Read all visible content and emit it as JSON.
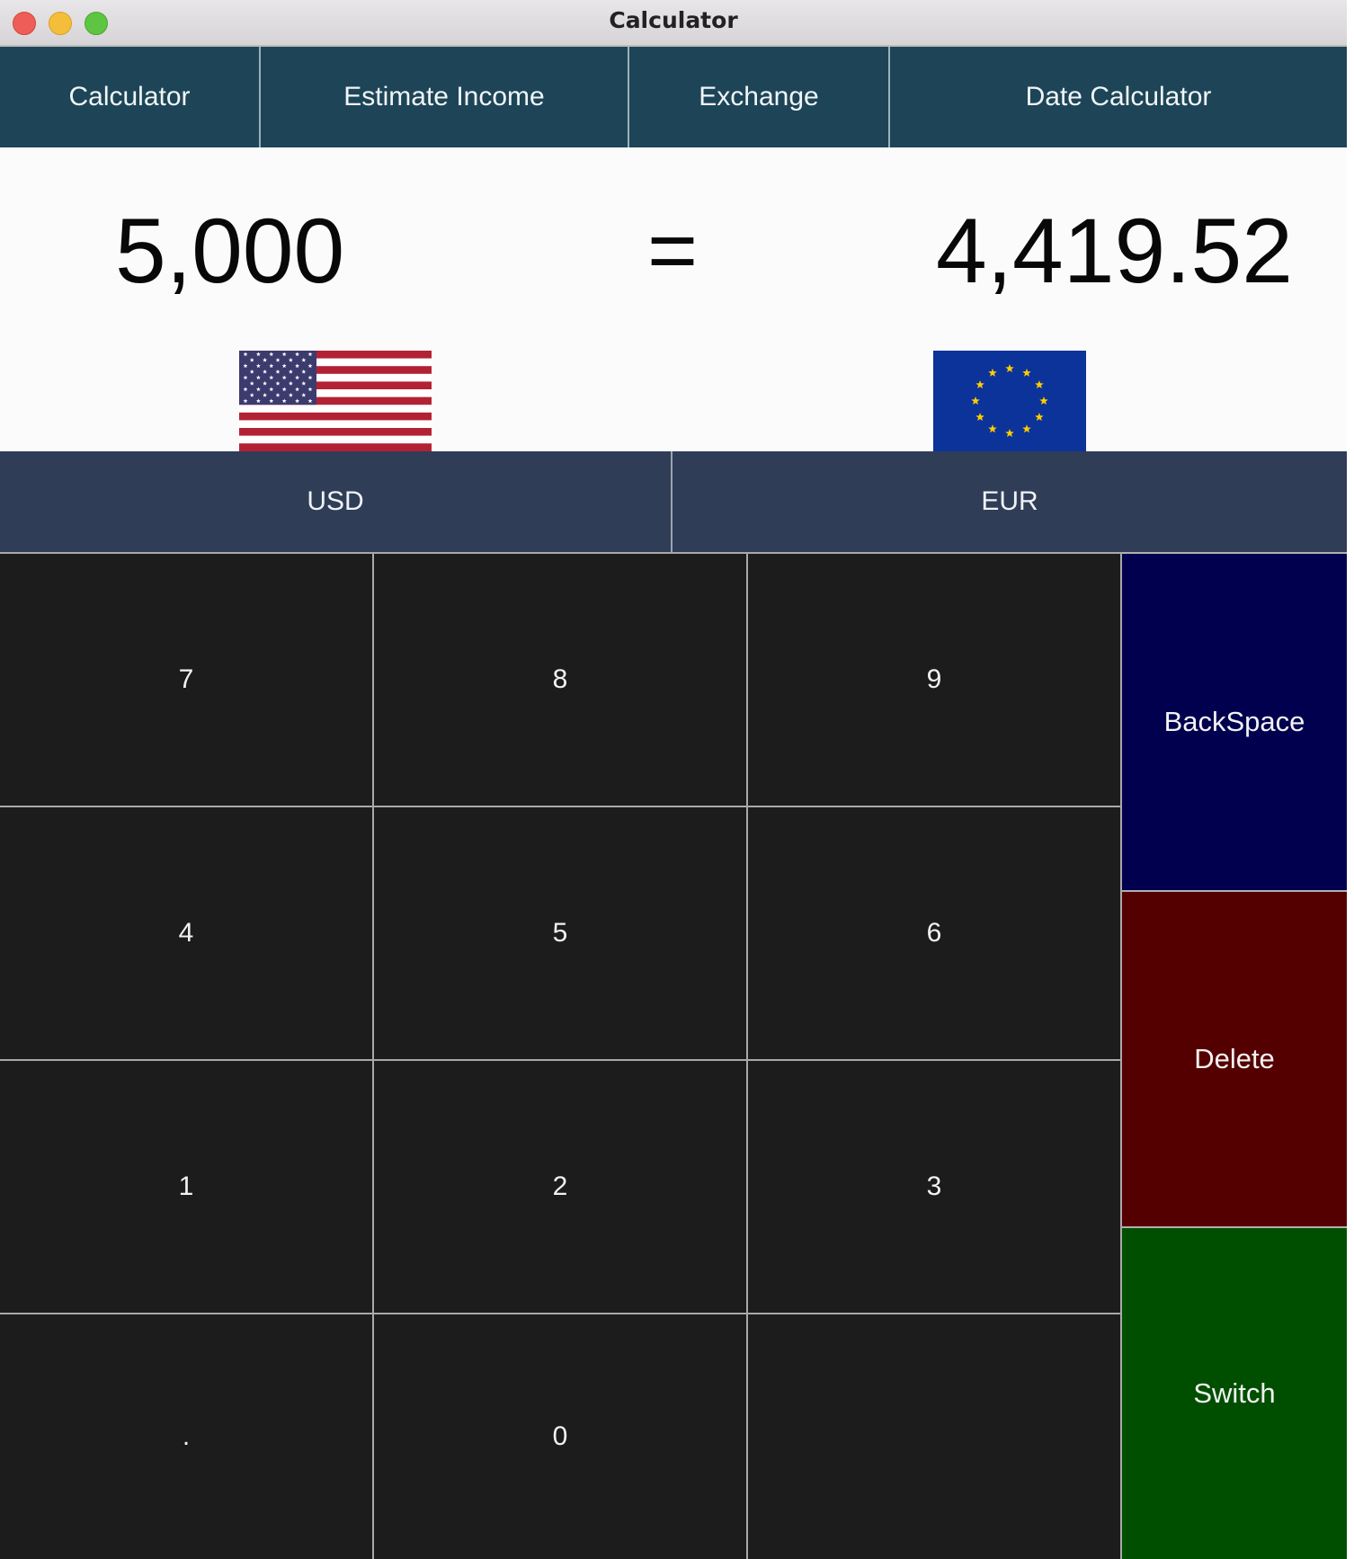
{
  "window": {
    "title": "Calculator"
  },
  "tabs": [
    {
      "label": "Calculator"
    },
    {
      "label": "Estimate Income"
    },
    {
      "label": "Exchange"
    },
    {
      "label": "Date Calculator"
    }
  ],
  "display": {
    "input_value": "5,000",
    "equals": "=",
    "result_value": "4,419.52",
    "from_flag": "us-flag",
    "to_flag": "eu-flag"
  },
  "currencies": {
    "from": "USD",
    "to": "EUR"
  },
  "keypad": {
    "keys": [
      "7",
      "8",
      "9",
      "4",
      "5",
      "6",
      "1",
      "2",
      "3",
      ".",
      "0",
      ""
    ],
    "backspace": "BackSpace",
    "delete": "Delete",
    "switch": "Switch"
  },
  "colors": {
    "tab_bg": "#1d4557",
    "currency_bg": "#2f3d57",
    "key_bg": "#1c1c1d",
    "backspace_bg": "#00004f",
    "delete_bg": "#550000",
    "switch_bg": "#004f00"
  }
}
